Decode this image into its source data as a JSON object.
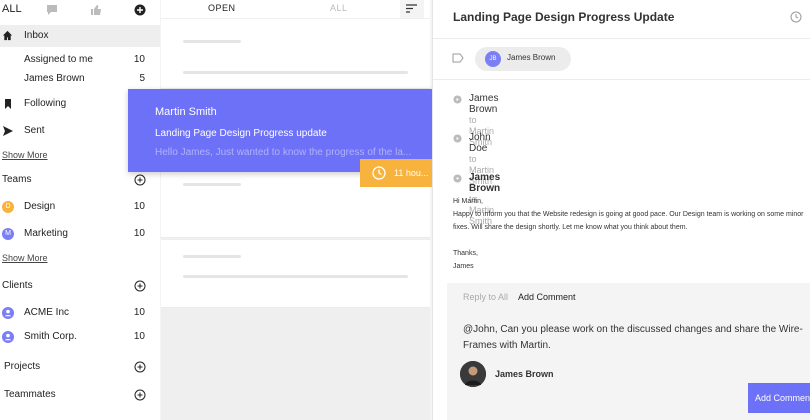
{
  "sidebar": {
    "all_label": "ALL",
    "inbox": "Inbox",
    "items": [
      {
        "label": "Assigned to me",
        "count": "10"
      },
      {
        "label": "James Brown",
        "count": "5"
      }
    ],
    "following": "Following",
    "sent": "Sent",
    "show_more": "Show More",
    "teams_header": "Teams",
    "teams": [
      {
        "initial": "D",
        "label": "Design",
        "count": "10",
        "color": "#f8b23e"
      },
      {
        "initial": "M",
        "label": "Marketing",
        "count": "10",
        "color": "#7b7ff5"
      }
    ],
    "show_more_2": "Show More",
    "clients_header": "Clients",
    "clients": [
      {
        "label": "ACME Inc",
        "count": "10"
      },
      {
        "label": "Smith Corp.",
        "count": "10"
      }
    ],
    "projects_header": "Projects",
    "teammates_header": "Teammates"
  },
  "middle": {
    "tab_open": "OPEN",
    "tab_all": "ALL",
    "popup": {
      "name": "Martin Smith",
      "subject": "Landing Page Design Progress update",
      "preview": "Hello James,  Just wanted to know the progress of the la..."
    },
    "time_badge": "11 hou..."
  },
  "detail": {
    "title": "Landing Page Design Progress Update",
    "assignee_initials": "JB",
    "assignee_name": "James Brown",
    "messages": [
      {
        "from": "James Brown",
        "to": "to Martin Smith"
      },
      {
        "from": "John Doe",
        "to": "to Martin Smith"
      },
      {
        "from": "James Brown",
        "to": "to Martin Smith"
      }
    ],
    "body_lines": [
      "Hi Martin,",
      "Happy to inform you that the Website redesign is going at good pace. Our Design team is working on some minor",
      "fixes. Will share the design shortly. Let me know what you think about them.",
      "",
      "Thanks,",
      "James"
    ],
    "reply_tab": "Reply to All",
    "comment_tab": "Add Comment",
    "comment_text": "@John, Can you please work on the discussed changes and share the Wire-Frames with Martin.",
    "commenter_name": "James Brown",
    "add_button": "Add Comment"
  },
  "colors": {
    "accent": "#6c71f7",
    "badge": "#f8b23e"
  }
}
